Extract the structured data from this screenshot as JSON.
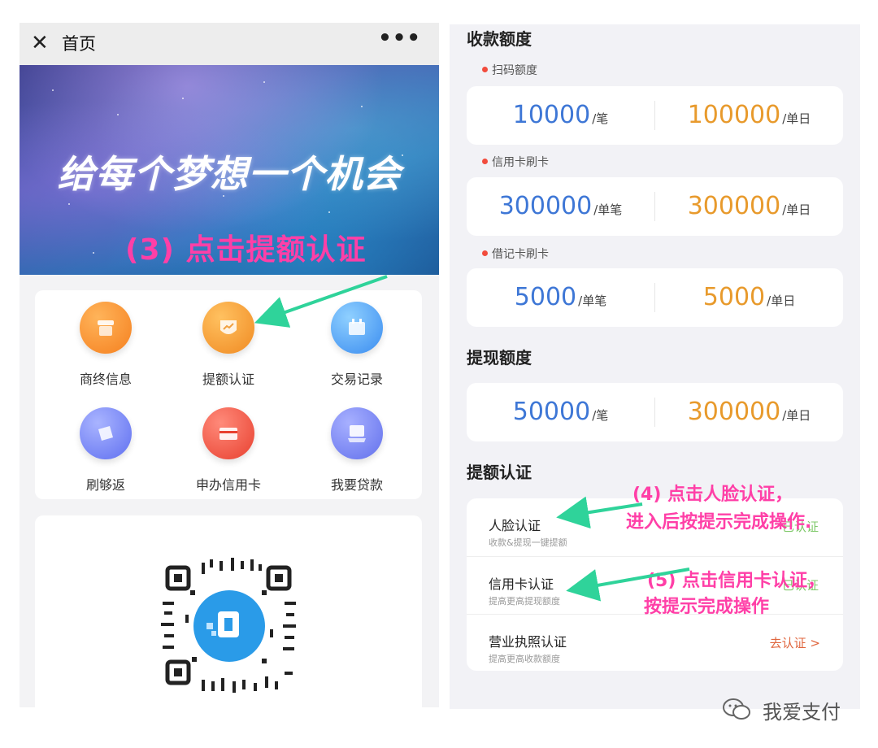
{
  "left": {
    "topbar": {
      "close": "✕",
      "title": "首页",
      "more": "•••"
    },
    "banner": {
      "slogan": "给每个梦想一个机会",
      "annotation": "(3) 点击提额认证"
    },
    "menu": [
      {
        "label": "商终信息",
        "icon": "store-icon",
        "color": "#f5891f"
      },
      {
        "label": "提额认证",
        "icon": "shield-chart-icon",
        "color": "#f29a2e"
      },
      {
        "label": "交易记录",
        "icon": "calendar-icon",
        "color": "#3d8ff0"
      },
      {
        "label": "刷够返",
        "icon": "ticket-icon",
        "color": "#6d7ff2"
      },
      {
        "label": "申办信用卡",
        "icon": "credit-card-icon",
        "color": "#ef4b3f"
      },
      {
        "label": "我要贷款",
        "icon": "loan-icon",
        "color": "#6f7cf0"
      }
    ],
    "qr": {
      "icon": "qr-code-icon"
    }
  },
  "right": {
    "receive_title": "收款额度",
    "scan": {
      "label": "扫码额度",
      "left_num": "10000",
      "left_unit": "/笔",
      "right_num": "100000",
      "right_unit": "/单日"
    },
    "credit": {
      "label": "信用卡刷卡",
      "left_num": "300000",
      "left_unit": "/单笔",
      "right_num": "300000",
      "right_unit": "/单日"
    },
    "debit": {
      "label": "借记卡刷卡",
      "left_num": "5000",
      "left_unit": "/单笔",
      "right_num": "5000",
      "right_unit": "/单日"
    },
    "withdraw_title": "提现额度",
    "withdraw": {
      "left_num": "50000",
      "left_unit": "/笔",
      "right_num": "300000",
      "right_unit": "/单日"
    },
    "cert_title": "提额认证",
    "certs": [
      {
        "name": "人脸认证",
        "desc": "收款&提现一键提额",
        "status": "已认证"
      },
      {
        "name": "信用卡认证",
        "desc": "提高更高提现额度",
        "status": "已认证"
      },
      {
        "name": "营业执照认证",
        "desc": "提高更高收款额度",
        "action": "去认证 >"
      }
    ],
    "annot4": [
      "(4) 点击人脸认证，",
      "进入后按提示完成操作."
    ],
    "annot5": [
      "(5) 点击信用卡认证，",
      "按提示完成操作"
    ]
  },
  "watermark": "我爱支付",
  "colors": {
    "annotation": "#ff3fa7",
    "arrow": "#2fd39a",
    "blue_num": "#3e77d6",
    "orange_num": "#e89a2c"
  }
}
